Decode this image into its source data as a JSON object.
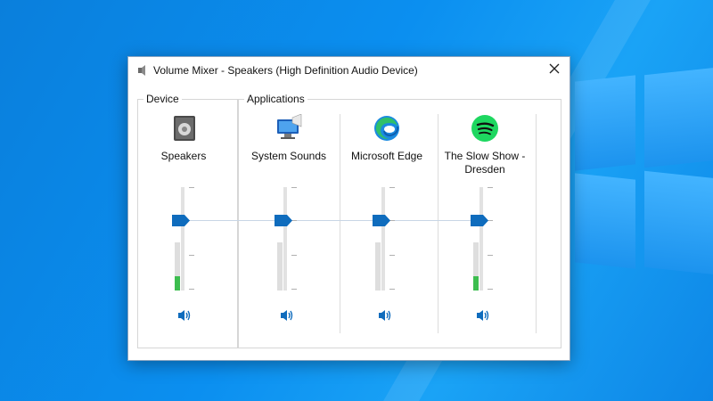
{
  "window": {
    "title": "Volume Mixer - Speakers (High Definition Audio Device)"
  },
  "device": {
    "group_label": "Device",
    "name": "Speakers",
    "volume_percent": 50,
    "level_meter_percent": 30
  },
  "applications": {
    "group_label": "Applications",
    "items": [
      {
        "name": "System Sounds",
        "volume_percent": 50,
        "level_meter_percent": 0
      },
      {
        "name": "Microsoft Edge",
        "volume_percent": 50,
        "level_meter_percent": 0
      },
      {
        "name": "The Slow Show - Dresden",
        "volume_percent": 50,
        "level_meter_percent": 30
      }
    ]
  },
  "colors": {
    "accent": "#0f6cbd",
    "meter": "#3dbd4f",
    "edge_primary": "#1b8be0",
    "spotify": "#1ed760"
  },
  "icons": [
    "speaker-icon",
    "close-icon",
    "speakers-device-icon",
    "system-sounds-icon",
    "microsoft-edge-icon",
    "spotify-icon",
    "volume-mute-icon"
  ]
}
